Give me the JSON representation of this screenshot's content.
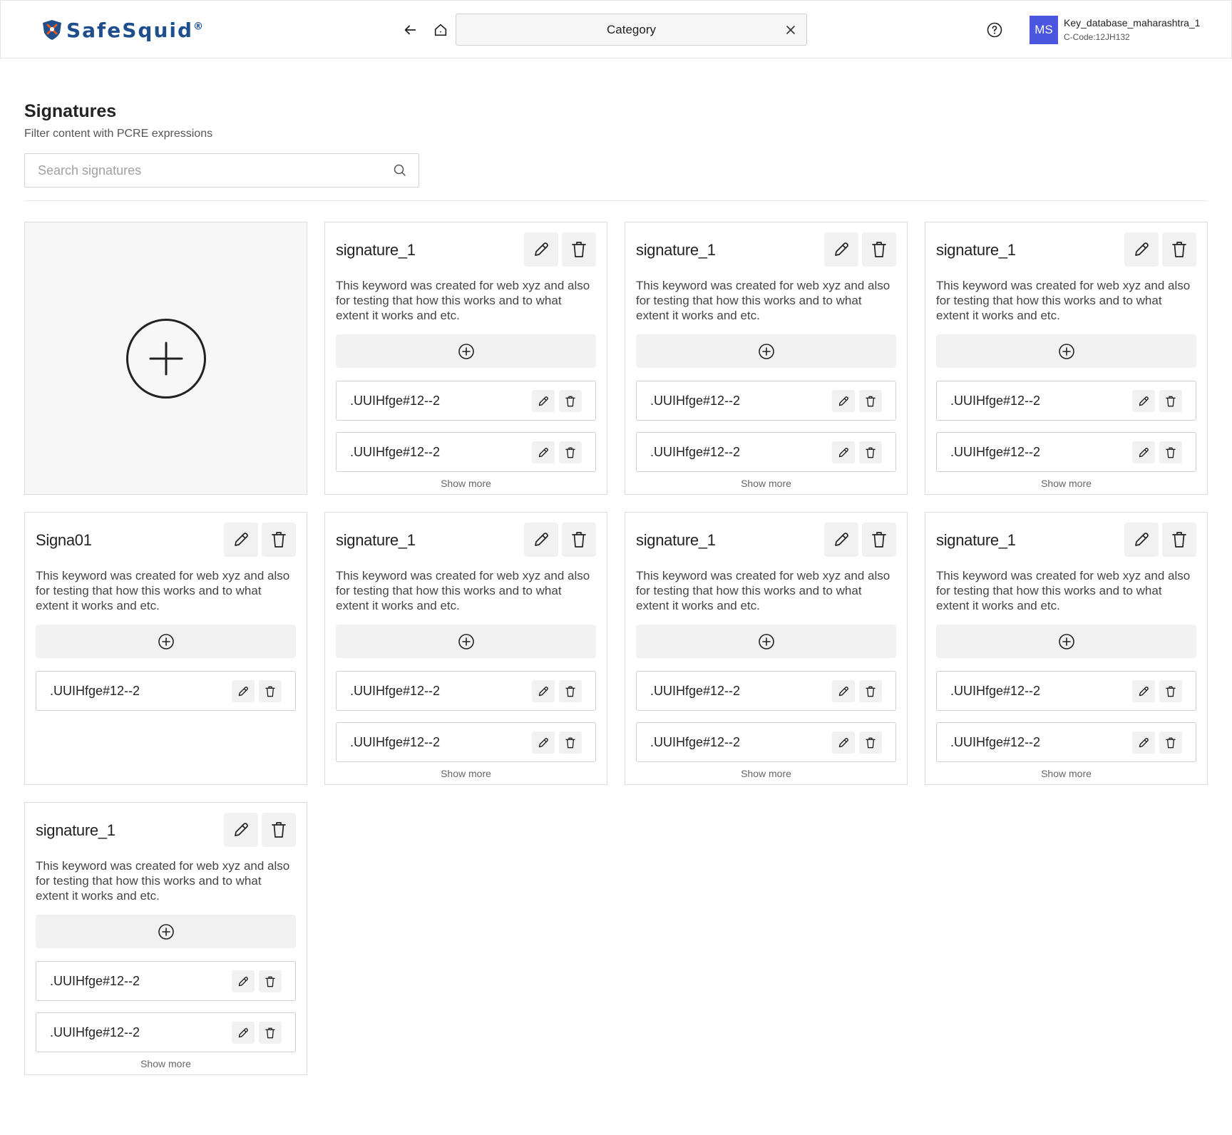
{
  "header": {
    "logo_text": "SafeSquid",
    "logo_mark": "®",
    "tab_label": "Category",
    "user_initials": "MS",
    "user_name": "Key_database_maharashtra_1",
    "user_code": "C-Code:12JH132",
    "avatar_color": "#4a55e0"
  },
  "page": {
    "title": "Signatures",
    "subtitle": "Filter content with PCRE expressions",
    "search_placeholder": "Search signatures"
  },
  "cards": [
    {
      "title": "signature_1",
      "description": "This keyword was created for web xyz and also for testing that how this works and to what extent it works and etc.",
      "entries": [
        ".UUIHfge#12--2",
        ".UUIHfge#12--2"
      ],
      "show_more": "Show more"
    },
    {
      "title": "signature_1",
      "description": "This keyword was created for web xyz and also for testing that how this works and to what extent it works and etc.",
      "entries": [
        ".UUIHfge#12--2",
        ".UUIHfge#12--2"
      ],
      "show_more": "Show more"
    },
    {
      "title": "signature_1",
      "description": "This keyword was created for web xyz and also for testing that how this works and to what extent it works and etc.",
      "entries": [
        ".UUIHfge#12--2",
        ".UUIHfge#12--2"
      ],
      "show_more": "Show more"
    },
    {
      "title": "Signa01",
      "description": "This keyword was created for web xyz and also for testing that how this works and to what extent it works and etc.",
      "entries": [
        ".UUIHfge#12--2"
      ],
      "show_more": ""
    },
    {
      "title": "signature_1",
      "description": "This keyword was created for web xyz and also for testing that how this works and to what extent it works and etc.",
      "entries": [
        ".UUIHfge#12--2",
        ".UUIHfge#12--2"
      ],
      "show_more": "Show more"
    },
    {
      "title": "signature_1",
      "description": "This keyword was created for web xyz and also for testing that how this works and to what extent it works and etc.",
      "entries": [
        ".UUIHfge#12--2",
        ".UUIHfge#12--2"
      ],
      "show_more": "Show more"
    },
    {
      "title": "signature_1",
      "description": "This keyword was created for web xyz and also for testing that how this works and to what extent it works and etc.",
      "entries": [
        ".UUIHfge#12--2",
        ".UUIHfge#12--2"
      ],
      "show_more": "Show more"
    },
    {
      "title": "signature_1",
      "description": "This keyword was created for web xyz and also for testing that how this works and to what extent it works and etc.",
      "entries": [
        ".UUIHfge#12--2",
        ".UUIHfge#12--2"
      ],
      "show_more": "Show more"
    }
  ]
}
